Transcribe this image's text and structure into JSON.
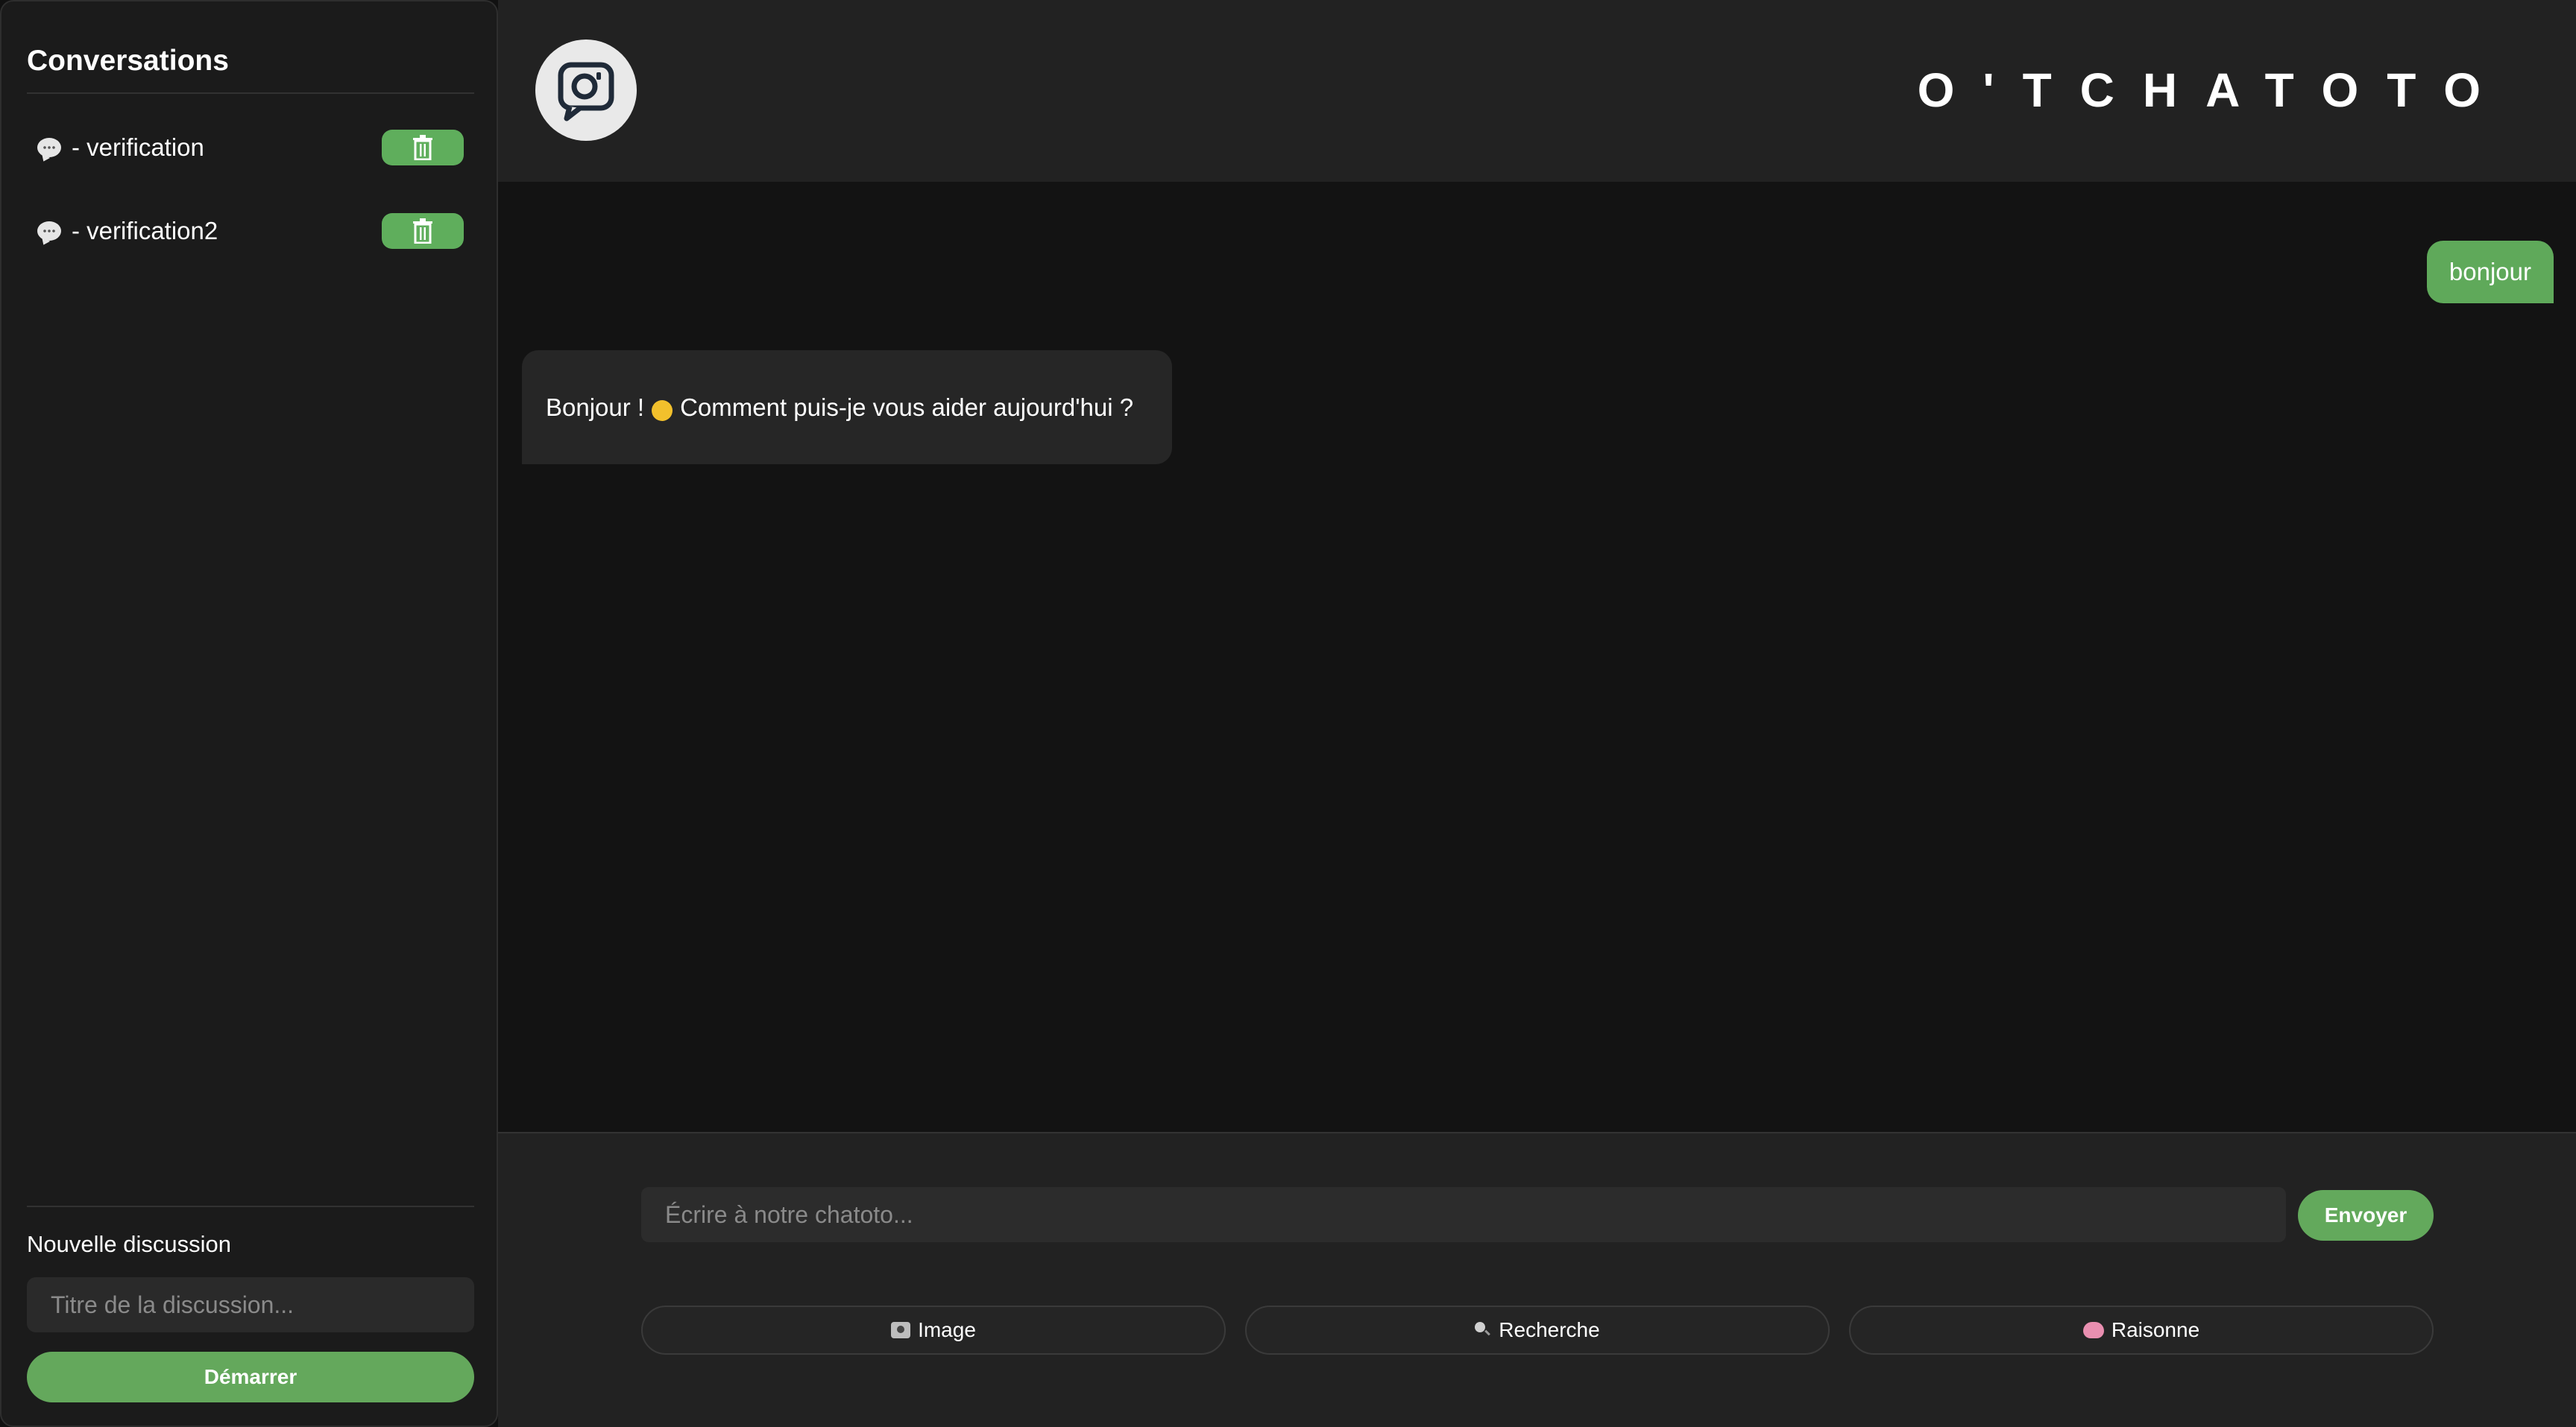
{
  "sidebar": {
    "title": "Conversations",
    "conversations": [
      {
        "label": "- verification"
      },
      {
        "label": "- verification2"
      }
    ],
    "new_discussion": {
      "label": "Nouvelle discussion",
      "placeholder": "Titre de la discussion...",
      "start_label": "Démarrer"
    }
  },
  "header": {
    "brand": "O'TCHATOTO",
    "logo_icon": "chat-camera-logo-icon"
  },
  "messages": [
    {
      "role": "user",
      "text": "bonjour"
    },
    {
      "role": "assistant",
      "text_before": "Bonjour !",
      "text_after": "Comment puis-je vous aider aujourd'hui ?"
    }
  ],
  "composer": {
    "placeholder": "Écrire à notre chatoto...",
    "send_label": "Envoyer",
    "modes": [
      {
        "label": "Image",
        "icon": "camera-icon"
      },
      {
        "label": "Recherche",
        "icon": "magnifier-icon"
      },
      {
        "label": "Raisonne",
        "icon": "brain-icon"
      }
    ]
  },
  "colors": {
    "accent": "#5fae5c",
    "sidebar_bg": "#1b1b1b",
    "header_bg": "#222222",
    "chat_bg": "#131313",
    "bot_bubble": "#262626"
  }
}
